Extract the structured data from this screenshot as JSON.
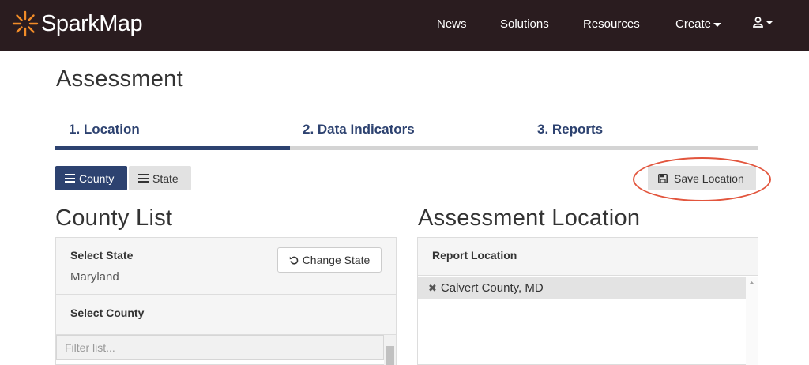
{
  "brand": {
    "name": "SparkMap",
    "accent": "#f28c28"
  },
  "nav": {
    "news": "News",
    "solutions": "Solutions",
    "resources": "Resources",
    "create": "Create",
    "user_icon": "user-icon"
  },
  "page": {
    "title": "Assessment"
  },
  "steps": {
    "location": "1. Location",
    "data_indicators": "2. Data Indicators",
    "reports": "3. Reports",
    "active": "1. Location"
  },
  "toggle": {
    "county": "County",
    "state": "State",
    "selected": "County"
  },
  "toolbar": {
    "save_location": "Save Location"
  },
  "county_list": {
    "title": "County List",
    "select_state_label": "Select State",
    "state_value": "Maryland",
    "change_state_label": "Change State",
    "select_county_label": "Select County",
    "filter_placeholder": "Filter list..."
  },
  "assessment_location": {
    "title": "Assessment Location",
    "report_location_label": "Report Location",
    "items": [
      "Calvert County, MD"
    ]
  },
  "colors": {
    "navbar_bg": "#2a1c1f",
    "primary": "#2d4270",
    "highlight_ring": "#e2553d"
  }
}
